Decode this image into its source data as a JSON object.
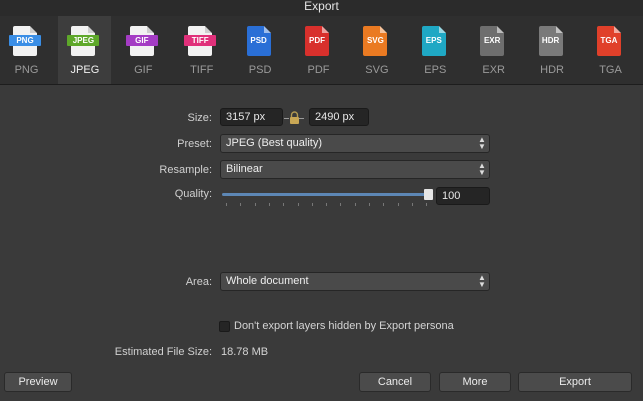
{
  "window": {
    "title": "Export"
  },
  "formats": [
    {
      "id": "png",
      "label": "PNG",
      "icon_label": "PNG",
      "color": "#3a8ee6",
      "colored": false,
      "selected": false
    },
    {
      "id": "jpeg",
      "label": "JPEG",
      "icon_label": "JPEG",
      "color": "#5ea82a",
      "colored": false,
      "selected": true
    },
    {
      "id": "gif",
      "label": "GIF",
      "icon_label": "GIF",
      "color": "#a43cc4",
      "colored": false,
      "selected": false
    },
    {
      "id": "tiff",
      "label": "TIFF",
      "icon_label": "TIFF",
      "color": "#e0307a",
      "colored": false,
      "selected": false
    },
    {
      "id": "psd",
      "label": "PSD",
      "icon_label": "PSD",
      "color": "#2a6fd6",
      "colored": true,
      "selected": false
    },
    {
      "id": "pdf",
      "label": "PDF",
      "icon_label": "PDF",
      "color": "#d8302c",
      "colored": true,
      "selected": false
    },
    {
      "id": "svg",
      "label": "SVG",
      "icon_label": "SVG",
      "color": "#ea7a22",
      "colored": true,
      "selected": false
    },
    {
      "id": "eps",
      "label": "EPS",
      "icon_label": "EPS",
      "color": "#1fa8c4",
      "colored": true,
      "selected": false
    },
    {
      "id": "exr",
      "label": "EXR",
      "icon_label": "EXR",
      "color": "#6e6e6e",
      "colored": true,
      "selected": false
    },
    {
      "id": "hdr",
      "label": "HDR",
      "icon_label": "HDR",
      "color": "#7a7a7a",
      "colored": true,
      "selected": false
    },
    {
      "id": "tga",
      "label": "TGA",
      "icon_label": "TGA",
      "color": "#e0402a",
      "colored": true,
      "selected": false
    }
  ],
  "size": {
    "label": "Size:",
    "width": "3157 px",
    "height": "2490 px"
  },
  "preset": {
    "label": "Preset:",
    "value": "JPEG (Best quality)"
  },
  "resample": {
    "label": "Resample:",
    "value": "Bilinear"
  },
  "quality": {
    "label": "Quality:",
    "value": "100",
    "level": 100,
    "max": 100
  },
  "area": {
    "label": "Area:",
    "value": "Whole document"
  },
  "hidden_layers": {
    "label": "Don't export layers hidden by Export persona",
    "checked": false
  },
  "estimate": {
    "label": "Estimated File Size:",
    "value": "18.78 MB"
  },
  "buttons": {
    "preview": "Preview",
    "cancel": "Cancel",
    "more": "More",
    "export": "Export"
  },
  "colors": {
    "accent": "#5d87b5",
    "background": "#3a3a3a"
  }
}
